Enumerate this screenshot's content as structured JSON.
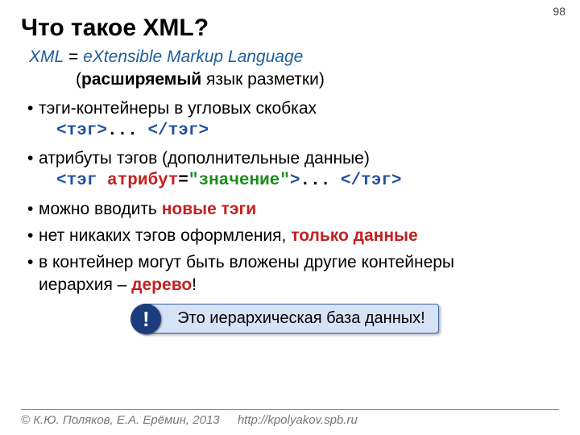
{
  "page_number": "98",
  "title": "Что такое XML?",
  "def": {
    "term": "XML",
    "eq": " = ",
    "expansion": "eXtensible Markup Language",
    "sub_open": "(",
    "sub_bold": "расширяемый",
    "sub_rest": " язык разметки)"
  },
  "bullets": {
    "b1": "тэги-контейнеры в угловых скобках",
    "code1": {
      "open": "<тэг>",
      "mid": "... ",
      "close": "</тэг>"
    },
    "b2": "атрибуты тэгов (дополнительные данные)",
    "code2": {
      "lt": "<",
      "tagname": "тэг ",
      "attr": "атрибут",
      "eq": "=",
      "val": "\"значение\"",
      "gt": ">",
      "mid": "... ",
      "close": "</тэг>"
    },
    "b3a": "можно вводить ",
    "b3b": "новые тэги",
    "b4a": "нет никаких тэгов оформления, ",
    "b4b": "только данные",
    "b5a": "в контейнер могут быть вложены другие контейнеры",
    "b5b": "иерархия – ",
    "b5c": "дерево",
    "b5d": "!"
  },
  "callout": {
    "bang": "!",
    "text": "Это иерархическая база данных!"
  },
  "footer": {
    "copyright": "© К.Ю. Поляков, Е.А. Ерёмин, 2013",
    "url": "http://kpolyakov.spb.ru"
  }
}
